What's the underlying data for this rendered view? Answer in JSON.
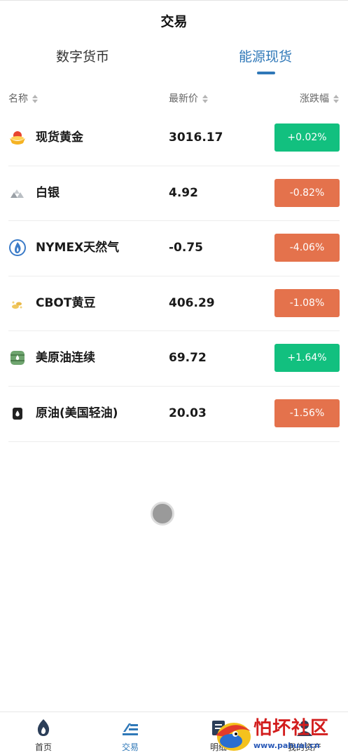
{
  "header": {
    "title": "交易"
  },
  "tabs": [
    {
      "label": "数字货币",
      "active": false
    },
    {
      "label": "能源现货",
      "active": true
    }
  ],
  "columns": {
    "name": "名称",
    "price": "最新价",
    "change": "涨跌幅"
  },
  "rows": [
    {
      "icon": "gold-ingot-icon",
      "name": "现货黄金",
      "price": "3016.17",
      "change": "+0.02%",
      "direction": "up"
    },
    {
      "icon": "silver-icon",
      "name": "白银",
      "price": "4.92",
      "change": "-0.82%",
      "direction": "down"
    },
    {
      "icon": "gas-flame-icon",
      "name": "NYMEX天然气",
      "price": "-0.75",
      "change": "-4.06%",
      "direction": "down"
    },
    {
      "icon": "soybean-icon",
      "name": "CBOT黄豆",
      "price": "406.29",
      "change": "-1.08%",
      "direction": "down"
    },
    {
      "icon": "oil-barrel-icon",
      "name": "美原油连续",
      "price": "69.72",
      "change": "+1.64%",
      "direction": "up"
    },
    {
      "icon": "oil-drop-icon",
      "name": "原油(美国轻油)",
      "price": "20.03",
      "change": "-1.56%",
      "direction": "down"
    }
  ],
  "tabbar": [
    {
      "icon": "flame-home-icon",
      "label": "首页",
      "active": false
    },
    {
      "icon": "trade-icon",
      "label": "交易",
      "active": true
    },
    {
      "icon": "detail-icon",
      "label": "明细",
      "active": false
    },
    {
      "icon": "assets-icon",
      "label": "我的资产",
      "active": false
    }
  ],
  "watermark": {
    "text": "怕坏社区",
    "url": "www.pahuai.cn"
  },
  "colors": {
    "accent": "#2f78b8",
    "up": "#12c07f",
    "down": "#e4724c"
  }
}
